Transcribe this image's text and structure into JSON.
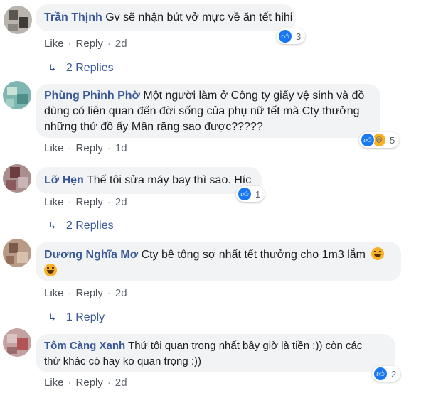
{
  "comments": [
    {
      "name": "Trần Thịnh",
      "text": "Gv sẽ nhận bút vở mực về ăn tết hihi",
      "like": "Like",
      "reply": "Reply",
      "time": "2d",
      "reactions": "3",
      "replies": "2 Replies"
    },
    {
      "name": "Phùng Phỉnh Phờ",
      "text_line1": "Một người làm ở Công ty giấy vệ sinh và đồ",
      "text_line2": "dùng có liên quan đến đời sống của phụ nữ tết mà Cty thưởng",
      "text_line3": "những thứ đồ ấy Mần răng sao được?????",
      "like": "Like",
      "reply": "Reply",
      "time": "1d",
      "reactions": "5"
    },
    {
      "name": "Lỡ Hẹn",
      "text": "Thế tôi sửa máy bay thì sao. Híc",
      "like": "Like",
      "reply": "Reply",
      "time": "2d",
      "reactions": "1",
      "replies": "2 Replies"
    },
    {
      "name": "Dương Nghĩa Mơ",
      "text": "Cty bê tông sợ nhất tết thưởng cho 1m3 lắm",
      "like": "Like",
      "reply": "Reply",
      "time": "2d",
      "replies": "1 Reply"
    },
    {
      "name": "Tôm Càng Xanh",
      "text_line1": "Thứ tôi quan trọng nhất bây giờ là tiền :)) còn các",
      "text_line2": "thứ khác có hay ko quan trọng :))",
      "like": "Like",
      "reply": "Reply",
      "time": "2d",
      "reactions": "2"
    }
  ],
  "icons": {
    "like": "like-icon",
    "haha": "haha-icon",
    "reply_arrow": "reply-arrow-icon"
  },
  "colors": {
    "name": "#385898",
    "bubble": "#f2f3f5",
    "like_blue": "#1877f2",
    "haha_yellow": "#f7b125"
  }
}
